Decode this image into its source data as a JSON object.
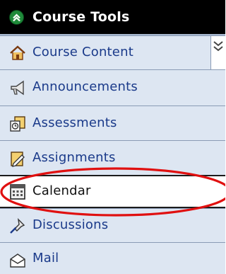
{
  "header": {
    "title": "Course Tools",
    "icon": "collapse-circle-icon"
  },
  "menu": {
    "items": [
      {
        "label": "Course Content",
        "icon": "home-icon"
      },
      {
        "label": "Announcements",
        "icon": "megaphone-icon"
      },
      {
        "label": "Assessments",
        "icon": "assessment-clipboard-icon"
      },
      {
        "label": "Assignments",
        "icon": "assignment-pencil-icon"
      },
      {
        "label": "Calendar",
        "icon": "calendar-icon",
        "selected": true
      },
      {
        "label": "Discussions",
        "icon": "pushpin-icon"
      },
      {
        "label": "Mail",
        "icon": "envelope-icon"
      }
    ]
  },
  "colors": {
    "header_bg": "#000000",
    "item_bg": "#dde6f2",
    "link_text": "#1a3a8a",
    "highlight_ellipse": "#e01010"
  }
}
